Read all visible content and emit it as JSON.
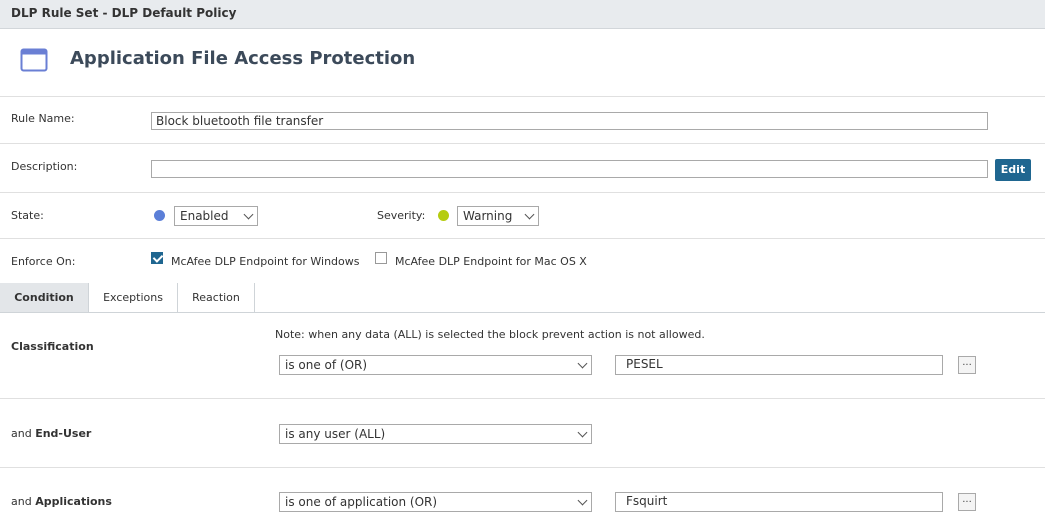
{
  "header": {
    "breadcrumb": "DLP Rule Set - DLP Default Policy"
  },
  "page": {
    "title": "Application File Access Protection",
    "icon": "window-icon"
  },
  "rule_name": {
    "label": "Rule Name:",
    "value": "Block bluetooth file transfer"
  },
  "description": {
    "label": "Description:",
    "value": "",
    "edit_label": "Edit"
  },
  "state": {
    "label": "State:",
    "value": "Enabled",
    "dot_color": "#5b7fd8"
  },
  "severity": {
    "label": "Severity:",
    "value": "Warning",
    "dot_color": "#b5cc10"
  },
  "enforce_on": {
    "label": "Enforce On:",
    "options": [
      {
        "label": "McAfee DLP Endpoint for Windows",
        "checked": true
      },
      {
        "label": "McAfee DLP Endpoint for Mac OS X",
        "checked": false
      }
    ]
  },
  "tabs": [
    {
      "label": "Condition",
      "active": true
    },
    {
      "label": "Exceptions",
      "active": false
    },
    {
      "label": "Reaction",
      "active": false
    }
  ],
  "condition": {
    "note": "Note: when any data (ALL) is selected the block prevent action is not allowed.",
    "classification": {
      "label": "Classification",
      "operator": "is one of (OR)",
      "value": "PESEL",
      "ellipsis": "..."
    },
    "end_user": {
      "prefix": "and ",
      "label": "End-User",
      "operator": "is any user (ALL)"
    },
    "applications": {
      "prefix": "and ",
      "label": "Applications",
      "operator": "is one of application (OR)",
      "value": "Fsquirt",
      "ellipsis": "..."
    }
  }
}
